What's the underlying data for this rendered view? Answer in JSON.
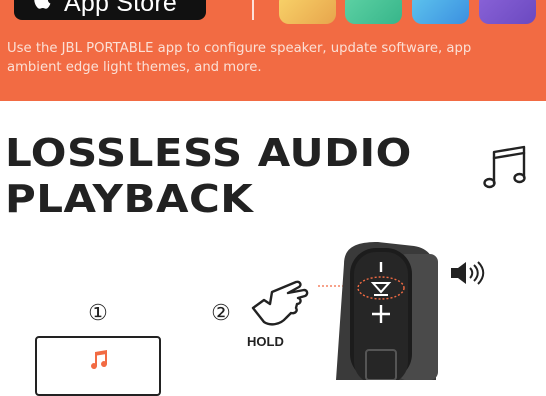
{
  "banner": {
    "store_button_label": "App Store",
    "description_line1": "Use the JBL PORTABLE app to configure speaker, update software, app",
    "description_line2": "ambient edge light themes, and more.",
    "background_color": "#f26b43"
  },
  "feature": {
    "title_line1": "LOSSLESS AUDIO",
    "title_line2": "PLAYBACK"
  },
  "steps": {
    "step1_label": "①",
    "step2_label": "②",
    "hold_label": "HOLD"
  },
  "icons": {
    "store": "apple-icon",
    "music": "music-note-icon",
    "hand": "pointing-hand-icon",
    "volume": "speaker-volume-icon"
  }
}
